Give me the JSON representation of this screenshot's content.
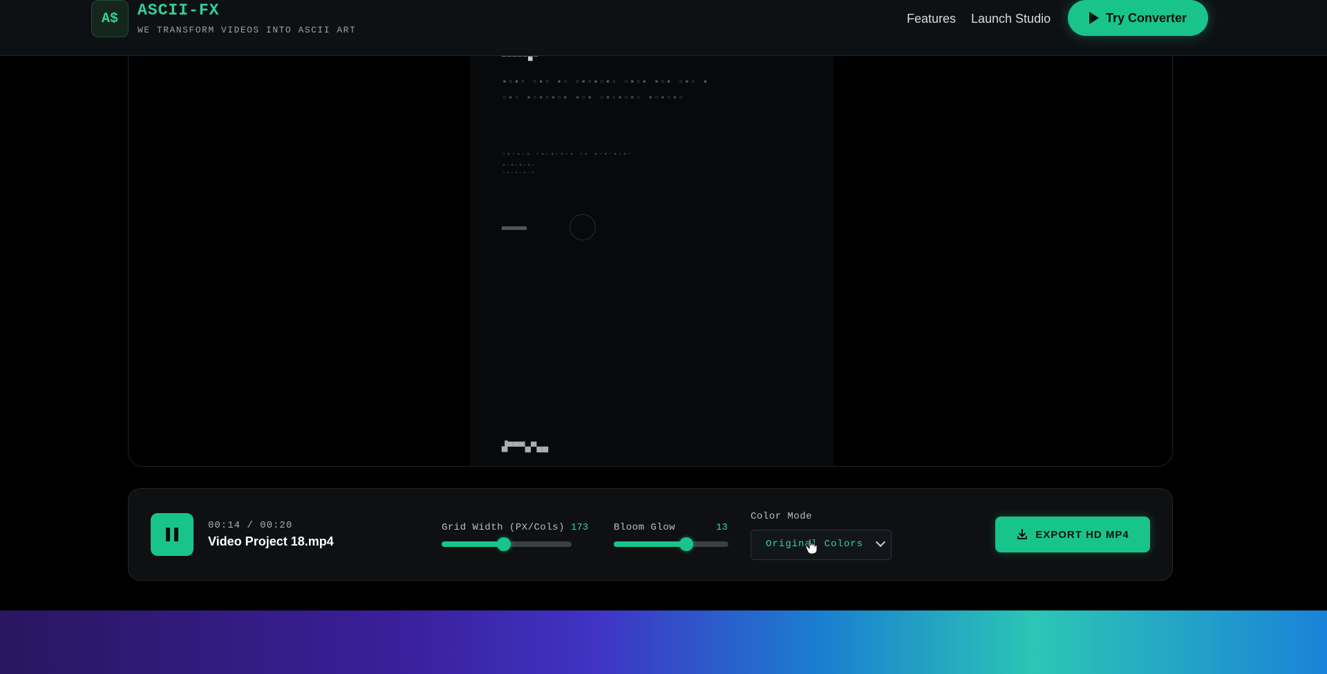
{
  "header": {
    "logo_text": "A$",
    "brand": "ASCII-FX",
    "tagline": "WE TRANSFORM VIDEOS INTO ASCII ART",
    "nav": [
      "Features",
      "Launch Studio"
    ],
    "cta_label": "Try Converter"
  },
  "player": {
    "time": "00:14 / 00:20",
    "file_name": "Video Project 18.mp4",
    "grid_width": {
      "label": "Grid Width (PX/Cols)",
      "value": "173",
      "fill_fraction": 0.48
    },
    "bloom_glow": {
      "label": "Bloom Glow",
      "value": "13",
      "fill_fraction": 0.63
    },
    "color_mode": {
      "label": "Color Mode",
      "selected": "Original Colors"
    },
    "export_label": "EXPORT HD MP4"
  },
  "colors": {
    "accent": "#18c48a",
    "accent_text": "#2fd49a",
    "background": "#000000",
    "panel": "#0e1012"
  }
}
